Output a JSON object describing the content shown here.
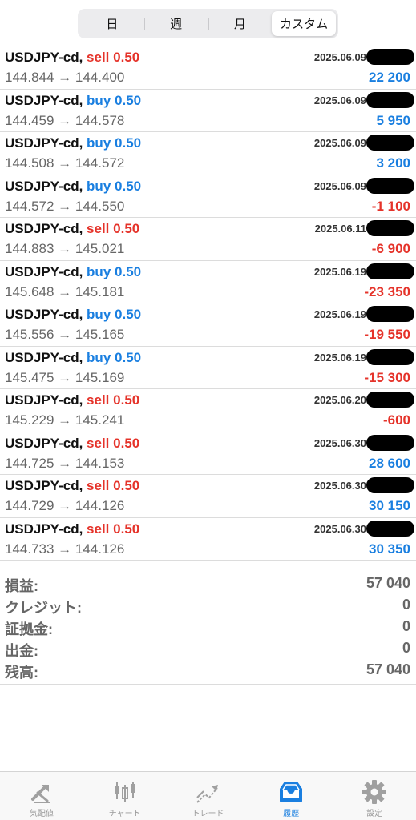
{
  "segment": {
    "options": [
      "日",
      "週",
      "月",
      "カスタム"
    ],
    "selected": "カスタム"
  },
  "trades": [
    {
      "symbol": "USDJPY-cd,",
      "side": "sell",
      "volume": "0.50",
      "date": "2025.06.09",
      "prices": "144.844 → 144.400",
      "profit": "22 200",
      "profit_sign": "pos"
    },
    {
      "symbol": "USDJPY-cd,",
      "side": "buy",
      "volume": "0.50",
      "date": "2025.06.09",
      "prices": "144.459 → 144.578",
      "profit": "5 950",
      "profit_sign": "pos"
    },
    {
      "symbol": "USDJPY-cd,",
      "side": "buy",
      "volume": "0.50",
      "date": "2025.06.09",
      "prices": "144.508 → 144.572",
      "profit": "3 200",
      "profit_sign": "pos"
    },
    {
      "symbol": "USDJPY-cd,",
      "side": "buy",
      "volume": "0.50",
      "date": "2025.06.09",
      "prices": "144.572 → 144.550",
      "profit": "-1 100",
      "profit_sign": "neg"
    },
    {
      "symbol": "USDJPY-cd,",
      "side": "sell",
      "volume": "0.50",
      "date": "2025.06.11",
      "prices": "144.883 → 145.021",
      "profit": "-6 900",
      "profit_sign": "neg"
    },
    {
      "symbol": "USDJPY-cd,",
      "side": "buy",
      "volume": "0.50",
      "date": "2025.06.19",
      "prices": "145.648 → 145.181",
      "profit": "-23 350",
      "profit_sign": "neg"
    },
    {
      "symbol": "USDJPY-cd,",
      "side": "buy",
      "volume": "0.50",
      "date": "2025.06.19",
      "prices": "145.556 → 145.165",
      "profit": "-19 550",
      "profit_sign": "neg"
    },
    {
      "symbol": "USDJPY-cd,",
      "side": "buy",
      "volume": "0.50",
      "date": "2025.06.19",
      "prices": "145.475 → 145.169",
      "profit": "-15 300",
      "profit_sign": "neg"
    },
    {
      "symbol": "USDJPY-cd,",
      "side": "sell",
      "volume": "0.50",
      "date": "2025.06.20",
      "prices": "145.229 → 145.241",
      "profit": "-600",
      "profit_sign": "neg"
    },
    {
      "symbol": "USDJPY-cd,",
      "side": "sell",
      "volume": "0.50",
      "date": "2025.06.30",
      "prices": "144.725 → 144.153",
      "profit": "28 600",
      "profit_sign": "pos"
    },
    {
      "symbol": "USDJPY-cd,",
      "side": "sell",
      "volume": "0.50",
      "date": "2025.06.30",
      "prices": "144.729 → 144.126",
      "profit": "30 150",
      "profit_sign": "pos"
    },
    {
      "symbol": "USDJPY-cd,",
      "side": "sell",
      "volume": "0.50",
      "date": "2025.06.30",
      "prices": "144.733 → 144.126",
      "profit": "30 350",
      "profit_sign": "pos"
    }
  ],
  "summary": [
    {
      "label": "損益:",
      "value": "57 040"
    },
    {
      "label": "クレジット:",
      "value": "0"
    },
    {
      "label": "証拠金:",
      "value": "0"
    },
    {
      "label": "出金:",
      "value": "0"
    },
    {
      "label": "残高:",
      "value": "57 040"
    }
  ],
  "tabbar": [
    {
      "label": "気配値",
      "icon": "quotes-icon",
      "active": false
    },
    {
      "label": "チャート",
      "icon": "chart-icon",
      "active": false
    },
    {
      "label": "トレード",
      "icon": "trade-icon",
      "active": false
    },
    {
      "label": "履歴",
      "icon": "history-icon",
      "active": true
    },
    {
      "label": "設定",
      "icon": "settings-icon",
      "active": false
    }
  ],
  "colors": {
    "sell": "#e5332a",
    "buy": "#1a7fe0",
    "profit_positive": "#1a7fe0",
    "profit_negative": "#e5332a",
    "tab_active": "#1a7fe0",
    "tab_inactive": "#9a9a9a"
  }
}
